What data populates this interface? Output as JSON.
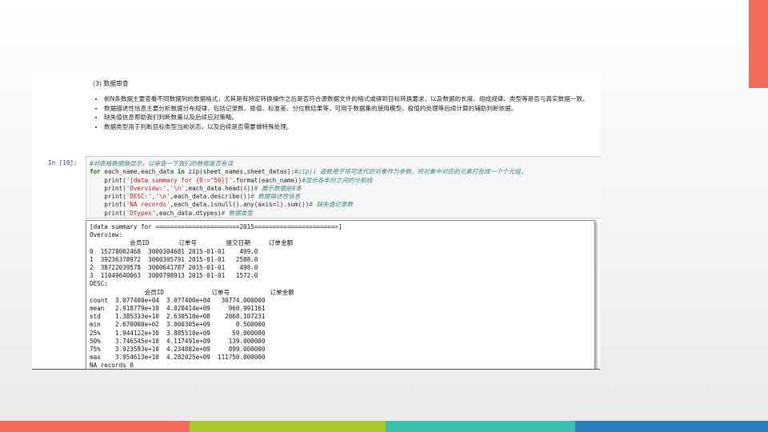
{
  "colors": {
    "accent_top_right": "#f26b5b",
    "stripes": [
      "#f26b5b",
      "#a8c82e",
      "#3cbfae",
      "#2a7fc0"
    ]
  },
  "markdown": {
    "title": "(3) 数据审查",
    "bullets": [
      "前N条数据主要查看不同数据列的数据格式，尤其是有特定转换操作之后是否符合源数据文件的格式或得到目标转换要求，以及数据的长度、组成规律、类型等是否与真实数据一致。",
      "数据描述性信息主要分析数据分布规律，包括记录数、极值、标准差、分位数结果等，可用于数据集的使用模型、极值的处理等后续计算的辅助判断依据。",
      "缺失值信息帮助我们判断数量以及后续应对策略。",
      "数据类型用于判断目标类型当前状态，以及后续是否需要做特殊处理。"
    ]
  },
  "cell": {
    "prompt": "In [10]:",
    "code": {
      "l1_comment": "#对表格数据做显示，以审查一下我们的数据是否有误",
      "l2_kw_for": "for",
      "l2_a": " each_name,each_data ",
      "l2_kw_in": "in",
      "l2_b": " zip(sheet_names,sheet_datas):",
      "l2_comment": "#zip() 函数用于将可迭代的对象作为参数，将对象中对应的元素打包成一个个元组，",
      "l3_a": "    print(",
      "l3_str": "'[data summary for {0:=^50}]'",
      "l3_b": ".format(each_name))",
      "l3_comment": "#显示各年份之间的分割线",
      "l4_a": "    print(",
      "l4_str": "'Overview:','\\n'",
      "l4_b": ",each_data.head(",
      "l4_num": "4",
      "l4_c": "))",
      "l4_comment": "# 展示数据前4条",
      "l5_a": "    print(",
      "l5_str": "'DESC:','\\n'",
      "l5_b": ",each_data.describe())",
      "l5_comment": "# 数据描述性信息",
      "l6_a": "    print(",
      "l6_str": "'NA records'",
      "l6_b": ",each_data.isnull().any(axis",
      "l6_op": "=",
      "l6_num": "1",
      "l6_c": ").sum())",
      "l6_comment": "# 缺失值记录数",
      "l7_a": "    print(",
      "l7_str": "'Dtypes'",
      "l7_b": ",each_data.dtypes)",
      "l7_comment": "# 数据类型"
    }
  },
  "output": {
    "lines": [
      "[data summary for =======================2015=======================]",
      "Overview:",
      "           会员ID        订单号        提交日期     订单金额",
      "0  15278002468  3000304681 2015-01-01    499.0",
      "1  39236378972  3000305791 2015-01-01   2588.0",
      "2  38722039578  3000641787 2015-01-01    498.0",
      "3  11049640063  3000798913 2015-01-01   1572.0",
      "DESC:",
      "               会员ID             订单号           订单金额",
      "count  3.077400e+04  3.077400e+04   30774.000000",
      "mean   2.918779e+10  4.020414e+09     960.991161",
      "std    1.385333e+10  2.630510e+08    2068.107231",
      "min    2.670000e+02  3.000305e+09       0.500000",
      "25%    1.944122e+10  3.885510e+09      59.000000",
      "50%    3.746545e+10  4.117491e+09     139.000000",
      "75%    3.923593e+10  4.234882e+09     899.000000",
      "max    3.954613e+10  4.282025e+09  111750.000000",
      "NA records 0"
    ]
  }
}
